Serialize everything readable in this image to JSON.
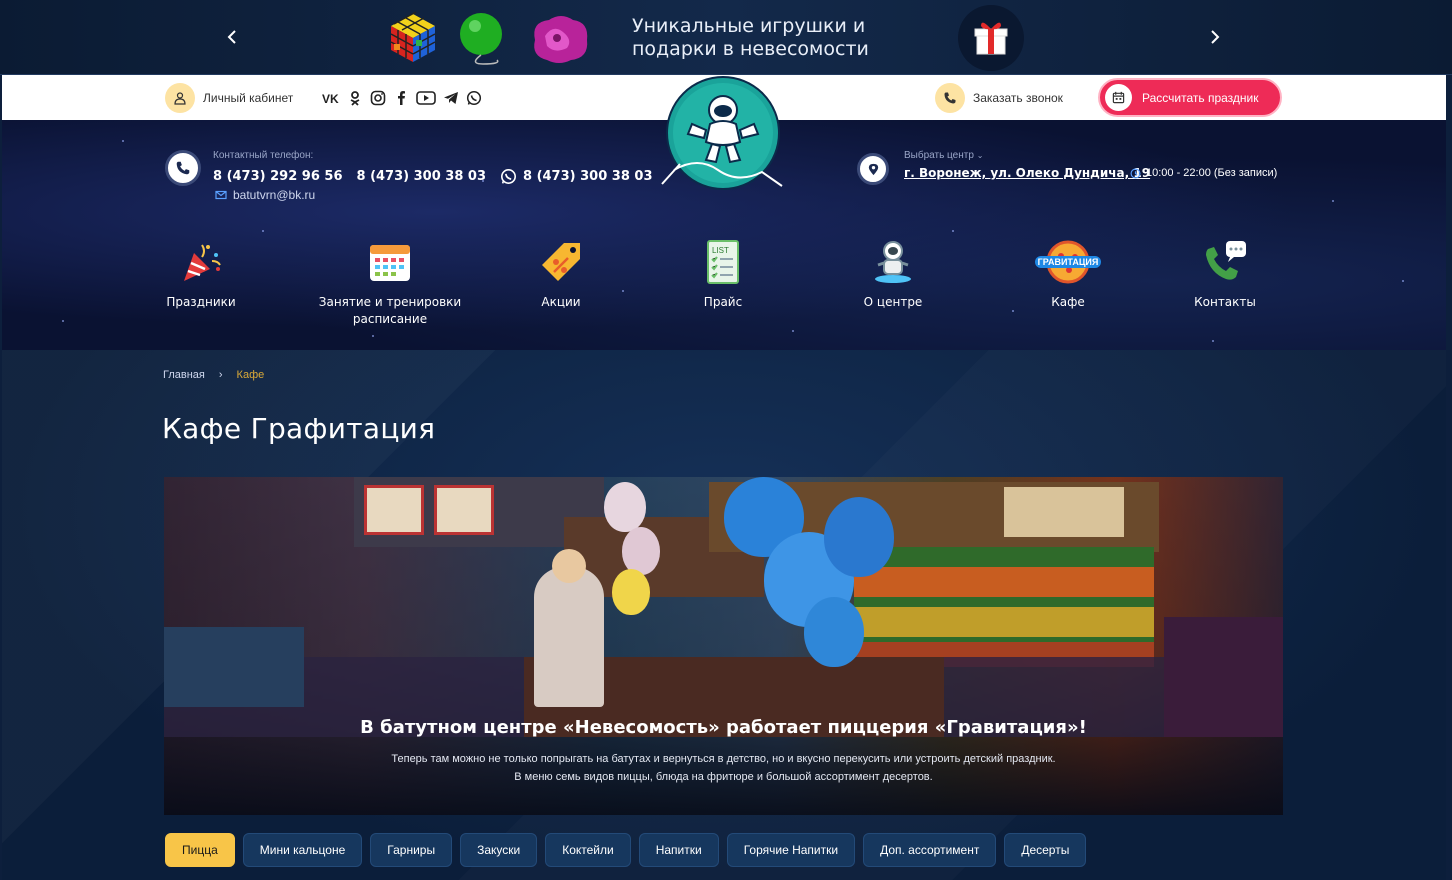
{
  "promo": {
    "text": "Уникальные игрушки и подарки в невесомости"
  },
  "topbar": {
    "cabinet_label": "Личный кабинет",
    "socials": [
      "vk-icon",
      "ok-icon",
      "instagram-icon",
      "facebook-icon",
      "youtube-icon",
      "telegram-icon",
      "whatsapp-icon"
    ],
    "callback_label": "Заказать звонок",
    "calc_label": "Рассчитать праздник"
  },
  "contacts": {
    "label": "Контактный телефон:",
    "phone1": "8 (473) 292 96 56",
    "phone2": "8 (473) 300 38 03",
    "phone3": "8 (473) 300 38 03",
    "email": "batutvrn@bk.ru"
  },
  "center": {
    "label": "Выбрать центр",
    "address": "г. Воронеж, ул. Олеко Дундича, 19",
    "hours": "10:00 - 22:00 (Без записи)"
  },
  "nav": [
    {
      "label": "Праздники",
      "icon": "party-popper-icon"
    },
    {
      "label": "Занятие и тренировки\nрасписание",
      "icon": "calendar-icon"
    },
    {
      "label": "Акции",
      "icon": "discount-tag-icon"
    },
    {
      "label": "Прайс",
      "icon": "price-list-icon"
    },
    {
      "label": "О центре",
      "icon": "astronaut-icon"
    },
    {
      "label": "Кафе",
      "icon": "pizza-logo-icon"
    },
    {
      "label": "Контакты",
      "icon": "phone-chat-icon"
    }
  ],
  "breadcrumb": {
    "home": "Главная",
    "separator": "›",
    "current": "Кафе"
  },
  "page": {
    "title": "Кафе Графитация"
  },
  "hero": {
    "title": "В батутном центре «Невесомость» работает пиццерия «Гравитация»!",
    "line1": "Теперь там можно не только попрыгать на батутах и вернуться в детство, но и вкусно перекусить или устроить детский праздник.",
    "line2": "В меню семь видов пиццы, блюда на фритюре и большой ассортимент десертов."
  },
  "tabs": [
    {
      "label": "Пицца",
      "active": true
    },
    {
      "label": "Мини кальцоне",
      "active": false
    },
    {
      "label": "Гарниры",
      "active": false
    },
    {
      "label": "Закуски",
      "active": false
    },
    {
      "label": "Коктейли",
      "active": false
    },
    {
      "label": "Напитки",
      "active": false
    },
    {
      "label": "Горячие Напитки",
      "active": false
    },
    {
      "label": "Доп. ассортимент",
      "active": false
    },
    {
      "label": "Десерты",
      "active": false
    }
  ],
  "colors": {
    "accent_pink": "#ee2b57",
    "accent_yellow": "#f8c548",
    "breadcrumb_current": "#d9a938",
    "tab_bg": "#16375e"
  }
}
